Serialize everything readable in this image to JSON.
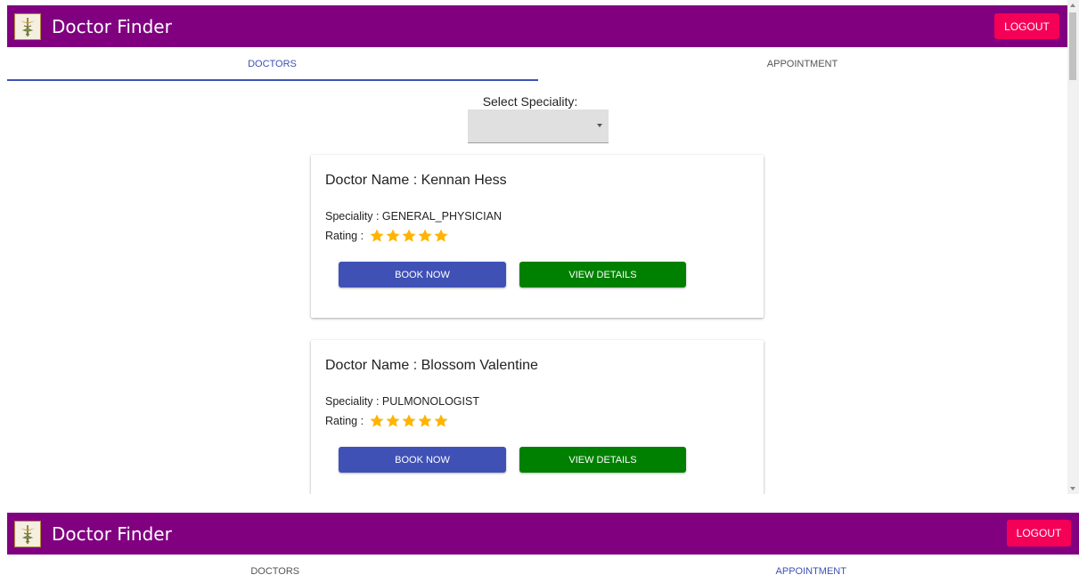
{
  "app": {
    "title": "Doctor Finder",
    "logout_label": "LOGOUT"
  },
  "tabs": [
    {
      "label": "DOCTORS"
    },
    {
      "label": "APPOINTMENT"
    }
  ],
  "filter": {
    "label": "Select Speciality:",
    "selected": ""
  },
  "doctors": [
    {
      "name": "Doctor Name : Kennan Hess",
      "speciality": "Speciality : GENERAL_PHYSICIAN",
      "rating_label": "Rating :",
      "rating": 5,
      "book_label": "BOOK NOW",
      "view_label": "VIEW DETAILS"
    },
    {
      "name": "Doctor Name : Blossom Valentine",
      "speciality": "Speciality : PULMONOLOGIST",
      "rating_label": "Rating :",
      "rating": 5,
      "book_label": "BOOK NOW",
      "view_label": "VIEW DETAILS"
    }
  ],
  "colors": {
    "header": "#800080",
    "logout": "#f50057",
    "primary": "#3f51b5",
    "view": "#008000",
    "star": "#ffb400"
  },
  "icons": {
    "logo": "caduceus-logo-icon",
    "star": "star-icon",
    "dropdown": "chevron-down-icon"
  }
}
